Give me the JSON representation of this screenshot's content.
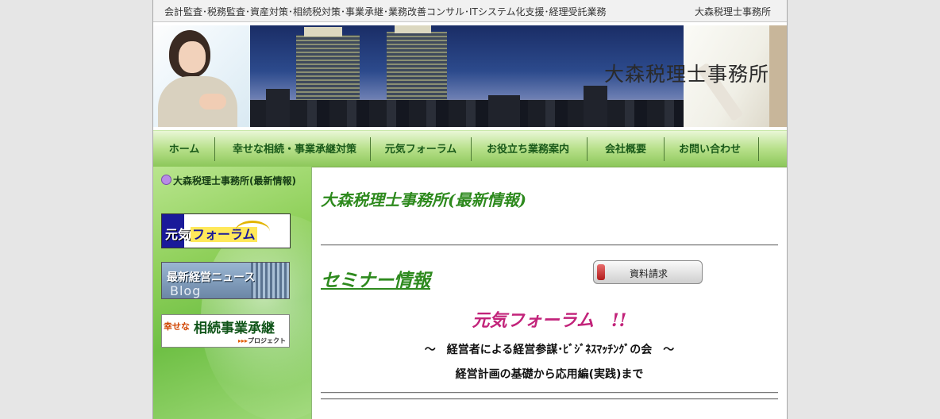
{
  "topbar": {
    "tagline": "会計監査･税務監査･資産対策･相続税対策･事業承継･業務改善コンサル･ITシステム化支援･経理受託業務",
    "firm": "大森税理士事務所"
  },
  "banner": {
    "logo_text": "大森税理士事務所"
  },
  "nav": {
    "items": [
      {
        "label": "ホーム"
      },
      {
        "label": "幸せな相続・事業承継対策"
      },
      {
        "label": "元気フォーラム"
      },
      {
        "label": "お役立ち業務案内"
      },
      {
        "label": "会社概要"
      },
      {
        "label": "お問い合わせ"
      }
    ]
  },
  "sidebar": {
    "title": "大森税理士事務所(最新情報)",
    "bullet_color": "#b88be6",
    "genki_banner": {
      "text_a": "元気",
      "text_b": "フォーラム"
    },
    "news_banner": {
      "line1": "最新経営ニュース",
      "line2": "Blog"
    },
    "souzoku_banner": {
      "prefix": "幸せな",
      "main": "相続事業承継",
      "arrows": "▸▸▸",
      "sub": "プロジェクト"
    }
  },
  "main": {
    "heading": "大森税理士事務所(最新情報)",
    "seminar_heading": "セミナー情報",
    "request_button": "資料請求",
    "forum_title": "元気フォーラム　!!",
    "subtitle": "～　経営者による経営参謀･ﾋﾞｼﾞﾈｽﾏｯﾁﾝｸﾞの会　～",
    "subtitle2": "経営計画の基礎から応用編(実践)まで"
  },
  "colors": {
    "heading_green": "#2e8a1e",
    "forum_pink": "#c2237a",
    "nav_green": "#8cc75a",
    "background": "#e6e6e6"
  }
}
